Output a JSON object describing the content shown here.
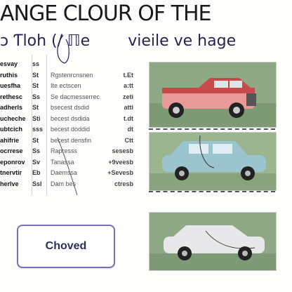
{
  "header": {
    "title": "ANGE CLOUR OF THE",
    "subtitle_left": "ɔ Ƭloh (/ ℿe",
    "subtitle_right": "vieile ve hage"
  },
  "table": {
    "rows": [
      {
        "c1": "esvay",
        "c2": "ss",
        "c3": "",
        "c4": ""
      },
      {
        "c1": "ruthis",
        "c2": "St",
        "c3": "Rgstenrcnsnen",
        "c4": "t.Et"
      },
      {
        "c1": "uesfha",
        "c2": "St",
        "c3": "Ite ectscen",
        "c4": "a:tt"
      },
      {
        "c1": "rethesc",
        "c2": "Ss",
        "c3": "Se dacmesserrec",
        "c4": "zeti"
      },
      {
        "c1": "adherls",
        "c2": "St",
        "c3": "bsecest dsdid",
        "c4": "atti"
      },
      {
        "c1": "ucheche",
        "c2": "Sti",
        "c3": "becest dsdida",
        "c4": "t.dt"
      },
      {
        "c1": "ubtcich",
        "c2": "sss",
        "c3": "becest doddid",
        "c4": "dt"
      },
      {
        "c1": "ahifrie",
        "c2": "St",
        "c3": "becest densfin",
        "c4": "Ctt"
      },
      {
        "c1": "ocrrese",
        "c2": "Ss",
        "c3": "Rapresss",
        "c4": "sesesb"
      },
      {
        "c1": "eponrov",
        "c2": "Sv",
        "c3": "Tanassa",
        "c4": "+9veesb"
      },
      {
        "c1": "tnervtir",
        "c2": "Eb",
        "c3": "Daemssa",
        "c4": "+Sevesb"
      },
      {
        "c1": "herlve",
        "c2": "Ssl",
        "c3": "Dam bes",
        "c4": "ctresb"
      }
    ]
  },
  "button": {
    "label": "Choved"
  },
  "colors": {
    "car1_body": "#c94a4a",
    "car1_lower": "#e89a9a",
    "car2_body": "#9cc4cf",
    "car3_body": "#e8e8ea",
    "grass": "#8fa885",
    "button_border": "#7a6fb0"
  }
}
